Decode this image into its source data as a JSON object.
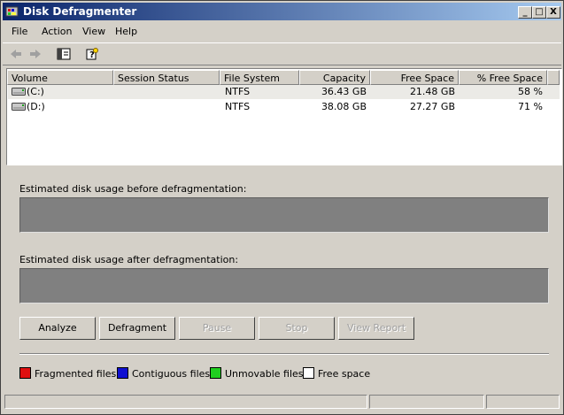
{
  "window": {
    "title": "Disk Defragmenter"
  },
  "titlebar_buttons": {
    "minimize": "_",
    "maximize": "□",
    "close": "X"
  },
  "menu": [
    "File",
    "Action",
    "View",
    "Help"
  ],
  "toolbar": {
    "icons": [
      "back-arrow-icon",
      "forward-arrow-icon",
      "show-hide-console-tree-icon",
      "help-icon"
    ]
  },
  "columns": [
    "Volume",
    "Session Status",
    "File System",
    "Capacity",
    "Free Space",
    "% Free Space"
  ],
  "volumes": [
    {
      "volume": "(C:)",
      "status": "",
      "fs": "NTFS",
      "capacity": "36.43 GB",
      "free": "21.48 GB",
      "pct": "58 %"
    },
    {
      "volume": "(D:)",
      "status": "",
      "fs": "NTFS",
      "capacity": "38.08 GB",
      "free": "27.27 GB",
      "pct": "71 %"
    }
  ],
  "estimates": {
    "before_label": "Estimated disk usage before defragmentation:",
    "after_label": "Estimated disk usage after defragmentation:"
  },
  "buttons": {
    "analyze": "Analyze",
    "defragment": "Defragment",
    "pause": "Pause",
    "stop": "Stop",
    "view_report": "View Report"
  },
  "legend": [
    {
      "label": "Fragmented files",
      "color": "#e01010"
    },
    {
      "label": "Contiguous files",
      "color": "#1010d0"
    },
    {
      "label": "Unmovable files",
      "color": "#20d020"
    },
    {
      "label": "Free space",
      "color": "#ffffff"
    }
  ],
  "colors": {
    "titlebar_start": "#0a246a",
    "titlebar_end": "#a6caf0",
    "usage_bar": "#808080"
  }
}
